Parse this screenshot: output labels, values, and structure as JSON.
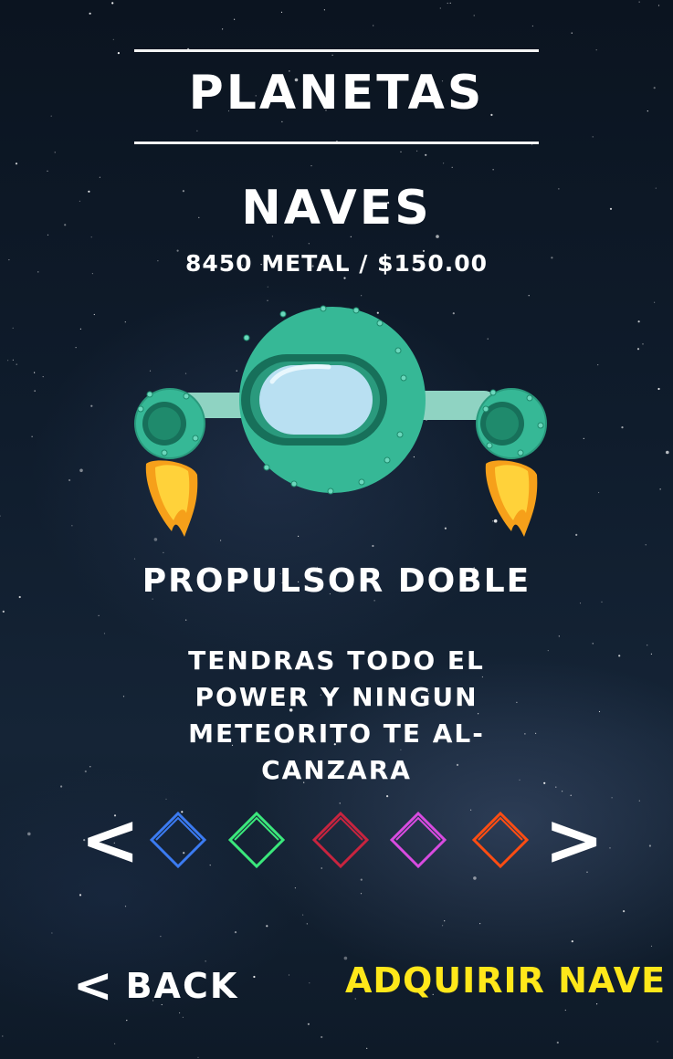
{
  "header": {
    "title": "PLANETAS"
  },
  "section": {
    "title": "NAVES",
    "price": "8450 METAL / $150.00"
  },
  "product": {
    "name": "PROPULSOR DOBLE",
    "description": "TENDRAS TODO EL POWER Y NINGUN METEORITO TE AL-CANZARA",
    "image_icon": "spaceship-icon"
  },
  "carousel": {
    "prev_label": "<",
    "next_label": ">",
    "swatches": [
      "#3b7bf2",
      "#3be87c",
      "#c8243f",
      "#d84be0",
      "#ff4d12"
    ]
  },
  "footer": {
    "back_label": "BACK",
    "back_icon": "<",
    "buy_label": "ADQUIRIR NAVE"
  },
  "colors": {
    "accent": "#ffe71a",
    "ship": "#36b896",
    "ship_dark": "#17705a",
    "glass": "#b9e0f2"
  }
}
